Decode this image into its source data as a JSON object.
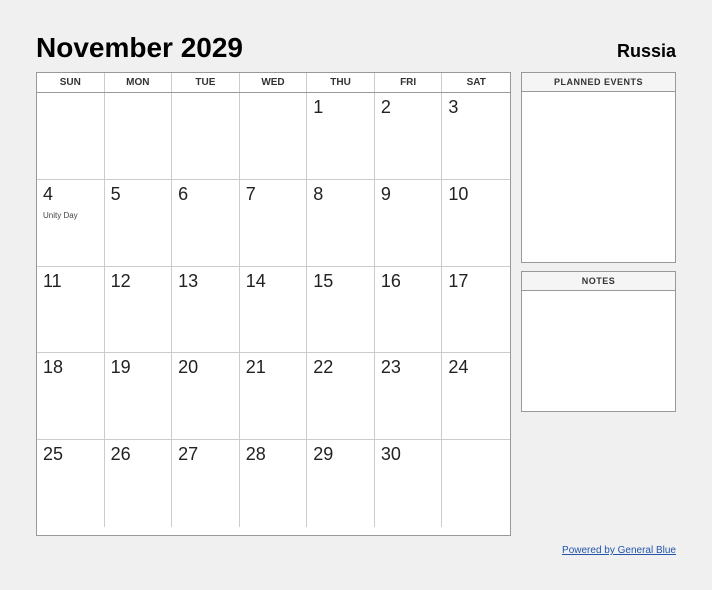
{
  "header": {
    "title": "November 2029",
    "country": "Russia"
  },
  "calendar": {
    "days_of_week": [
      "SUN",
      "MON",
      "TUE",
      "WED",
      "THU",
      "FRI",
      "SAT"
    ],
    "weeks": [
      [
        {
          "day": "",
          "empty": true
        },
        {
          "day": "",
          "empty": true
        },
        {
          "day": "",
          "empty": true
        },
        {
          "day": "",
          "empty": true
        },
        {
          "day": "1"
        },
        {
          "day": "2"
        },
        {
          "day": "3"
        }
      ],
      [
        {
          "day": "4",
          "event": "Unity Day"
        },
        {
          "day": "5"
        },
        {
          "day": "6"
        },
        {
          "day": "7"
        },
        {
          "day": "8"
        },
        {
          "day": "9"
        },
        {
          "day": "10"
        }
      ],
      [
        {
          "day": "11"
        },
        {
          "day": "12"
        },
        {
          "day": "13"
        },
        {
          "day": "14"
        },
        {
          "day": "15"
        },
        {
          "day": "16"
        },
        {
          "day": "17"
        }
      ],
      [
        {
          "day": "18"
        },
        {
          "day": "19"
        },
        {
          "day": "20"
        },
        {
          "day": "21"
        },
        {
          "day": "22"
        },
        {
          "day": "23"
        },
        {
          "day": "24"
        }
      ],
      [
        {
          "day": "25"
        },
        {
          "day": "26"
        },
        {
          "day": "27"
        },
        {
          "day": "28"
        },
        {
          "day": "29"
        },
        {
          "day": "30"
        },
        {
          "day": "",
          "empty": true
        }
      ]
    ]
  },
  "sidebar": {
    "planned_events_label": "PLANNED EVENTS",
    "notes_label": "NOTES"
  },
  "footer": {
    "link_text": "Powered by General Blue"
  }
}
